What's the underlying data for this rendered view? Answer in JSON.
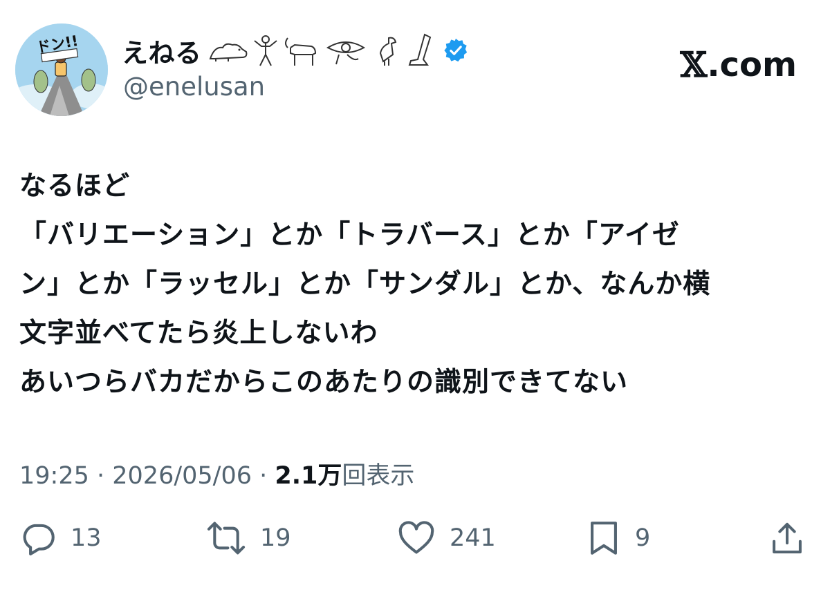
{
  "author": {
    "display_name": "えねる",
    "hieroglyphs": [
      "lion-glyph",
      "man-glyph",
      "ibex-glyph",
      "eye-of-horus-glyph",
      "falcon-glyph",
      "leg-glyph"
    ],
    "handle": "@enelusan",
    "verified": true,
    "verified_color": "#1d9bf0",
    "avatar_text": "ドン!!"
  },
  "brand": {
    "x_mark": "𝕏",
    "suffix": ".com"
  },
  "tweet": {
    "lines": [
      "なるほど",
      "「バリエーション」とか「トラバース」とか「アイゼ",
      "ン」とか「ラッセル」とか「サンダル」とか、なんか横",
      "文字並べてたら炎上しないわ",
      "あいつらバカだからこのあたりの識別できてない"
    ]
  },
  "meta": {
    "time": "19:25",
    "separator1": " · ",
    "date": "2026/05/06",
    "separator2": " · ",
    "views_count": "2.1万",
    "views_label": "回表示"
  },
  "actions": {
    "replies": "13",
    "reposts": "19",
    "likes": "241",
    "bookmarks": "9"
  },
  "colors": {
    "text_primary": "#0f1419",
    "text_secondary": "#536471",
    "accent": "#1d9bf0"
  }
}
